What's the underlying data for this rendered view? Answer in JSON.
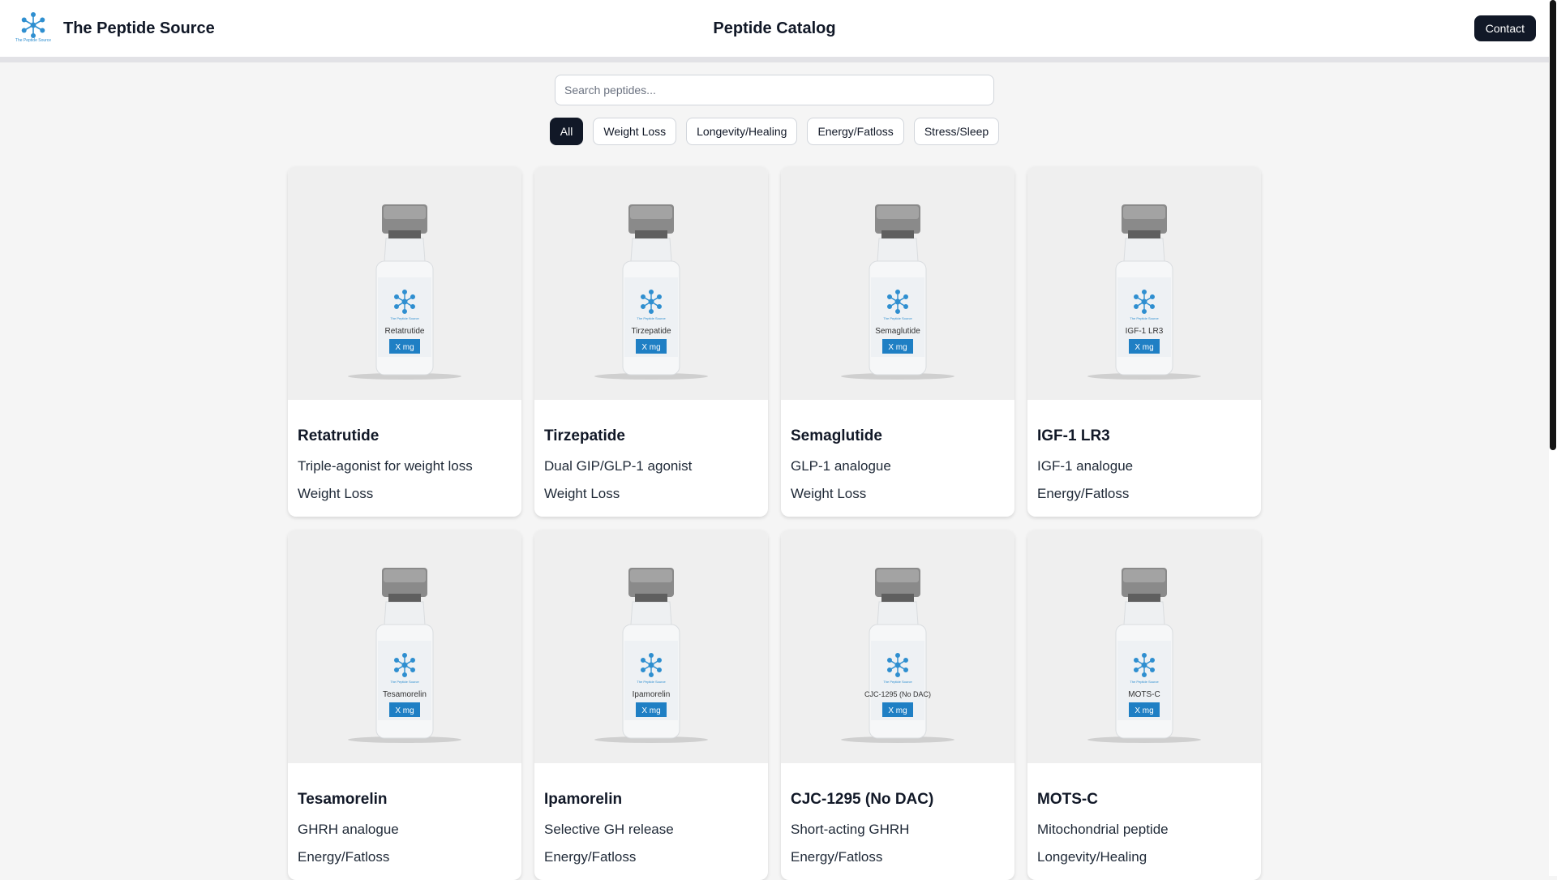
{
  "header": {
    "brand_name": "The Peptide Source",
    "logo_text": "The Peptide Source",
    "page_title": "Peptide Catalog",
    "contact_label": "Contact"
  },
  "search": {
    "placeholder": "Search peptides...",
    "value": ""
  },
  "filters": [
    {
      "label": "All",
      "active": true
    },
    {
      "label": "Weight Loss",
      "active": false
    },
    {
      "label": "Longevity/Healing",
      "active": false
    },
    {
      "label": "Energy/Fatloss",
      "active": false
    },
    {
      "label": "Stress/Sleep",
      "active": false
    }
  ],
  "products": [
    {
      "name": "Retatrutide",
      "vial_label": "Retatrutide",
      "description": "Triple-agonist for weight loss",
      "category": "Weight Loss"
    },
    {
      "name": "Tirzepatide",
      "vial_label": "Tirzepatide",
      "description": "Dual GIP/GLP-1 agonist",
      "category": "Weight Loss"
    },
    {
      "name": "Semaglutide",
      "vial_label": "Semaglutide",
      "description": "GLP-1 analogue",
      "category": "Weight Loss"
    },
    {
      "name": "IGF-1 LR3",
      "vial_label": "IGF-1 LR3",
      "description": "IGF-1 analogue",
      "category": "Energy/Fatloss"
    },
    {
      "name": "Tesamorelin",
      "vial_label": "Tesamorelin",
      "description": "GHRH analogue",
      "category": "Energy/Fatloss"
    },
    {
      "name": "Ipamorelin",
      "vial_label": "Ipamorelin",
      "description": "Selective GH release",
      "category": "Energy/Fatloss"
    },
    {
      "name": "CJC-1295 (No DAC)",
      "vial_label": "CJC-1295 (No DAC)",
      "description": "Short-acting GHRH",
      "category": "Energy/Fatloss"
    },
    {
      "name": "MOTS-C",
      "vial_label": "MOTS-C",
      "description": "Mitochondrial peptide",
      "category": "Longevity/Healing"
    }
  ],
  "vial": {
    "brand_text": "The Peptide Source",
    "dose_text": "X mg"
  },
  "colors": {
    "accent": "#111827",
    "logo_blue": "#2f8fd0",
    "dose_blue": "#1f7fc4"
  }
}
